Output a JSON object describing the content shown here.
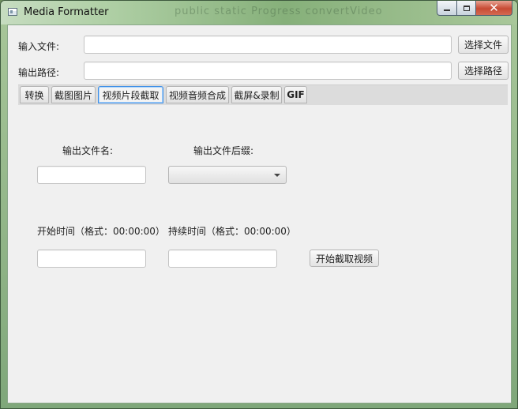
{
  "window": {
    "title": "Media Formatter",
    "background_ghost_text": "public static Progress convertVideo"
  },
  "input_row": {
    "label": "输入文件:",
    "value": "",
    "button": "选择文件"
  },
  "output_row": {
    "label": "输出路径:",
    "value": "",
    "button": "选择路径"
  },
  "tabs": [
    {
      "label": "转换",
      "active": false
    },
    {
      "label": "截图图片",
      "active": false
    },
    {
      "label": "视频片段截取",
      "active": true
    },
    {
      "label": "视频音频合成",
      "active": false
    },
    {
      "label": "截屏&录制",
      "active": false
    },
    {
      "label": "GIF",
      "active": false
    }
  ],
  "clip_panel": {
    "output_name_label": "输出文件名:",
    "output_name_value": "",
    "output_suffix_label": "输出文件后缀:",
    "output_suffix_selected": "",
    "start_time_label": "开始时间（格式：00:00:00）",
    "start_time_value": "",
    "duration_label": "持续时间（格式：00:00:00）",
    "duration_value": "",
    "start_button": "开始截取视频"
  },
  "colors": {
    "active_tab_border": "#3d8ee6",
    "close_button": "#c74b34",
    "panel_background": "#f0f0f0"
  }
}
